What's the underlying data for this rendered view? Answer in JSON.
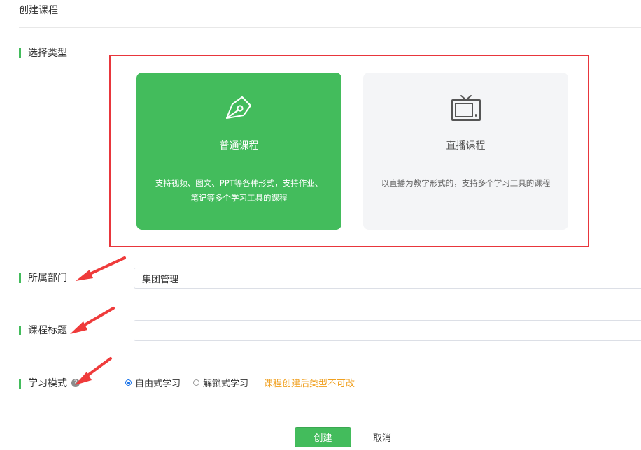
{
  "page": {
    "title": "创建课程"
  },
  "course_type": {
    "label": "选择类型",
    "options": [
      {
        "title": "普通课程",
        "description_line1": "支持视频、图文、PPT等各种形式，支持作业、",
        "description_line2": "笔记等多个学习工具的课程",
        "icon": "pen-nib-icon",
        "selected": true
      },
      {
        "title": "直播课程",
        "description_line1": "以直播为教学形式的，支持多个学习工具的课程",
        "icon": "tv-icon",
        "selected": false
      }
    ]
  },
  "department": {
    "label": "所属部门",
    "value": "集团管理"
  },
  "course_title": {
    "label": "课程标题",
    "value": ""
  },
  "study_mode": {
    "label": "学习模式",
    "help_icon": "question-icon",
    "options": [
      {
        "label": "自由式学习",
        "checked": true
      },
      {
        "label": "解锁式学习",
        "checked": false
      }
    ],
    "note": "课程创建后类型不可改"
  },
  "actions": {
    "create_label": "创建",
    "cancel_label": "取消"
  },
  "colors": {
    "accent": "#43bc5c",
    "highlight_frame": "#e8363c",
    "warning_text": "#f0a020",
    "radio_checked": "#1a73e8"
  }
}
